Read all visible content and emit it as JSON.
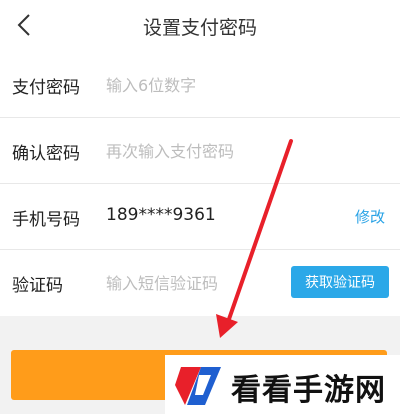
{
  "header": {
    "title": "设置支付密码"
  },
  "form": {
    "pay_password": {
      "label": "支付密码",
      "placeholder": "输入6位数字"
    },
    "confirm_password": {
      "label": "确认密码",
      "placeholder": "再次输入支付密码"
    },
    "phone": {
      "label": "手机号码",
      "value": "189****9361",
      "modify_label": "修改"
    },
    "verify_code": {
      "label": "验证码",
      "placeholder": "输入短信验证码",
      "button_label": "获取验证码"
    }
  },
  "watermark": {
    "text": "看看手游网"
  },
  "colors": {
    "accent_blue": "#2ba8e8",
    "submit_orange": "#ff9c1a",
    "annotation_arrow": "#e8202a"
  },
  "icons": {
    "back": "chevron-left-icon"
  }
}
